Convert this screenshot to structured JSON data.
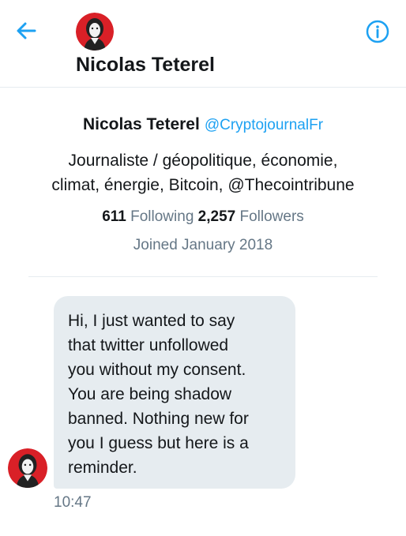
{
  "header": {
    "title": "Nicolas Teterel",
    "back_icon": "arrow-left-icon",
    "info_icon": "info-circle-icon",
    "accent_color": "#1da1f2"
  },
  "profile": {
    "name": "Nicolas Teterel",
    "handle": "@CryptojournalFr",
    "bio_line1": "Journaliste / géopolitique, économie,",
    "bio_line2": "climat, énergie, Bitcoin, @Thecointribune",
    "following_count": "611",
    "following_label": "Following",
    "followers_count": "2,257",
    "followers_label": "Followers",
    "joined": "Joined January 2018"
  },
  "message": {
    "text": "Hi, I just wanted to say\nthat twitter unfollowed\nyou without my consent.\nYou are being shadow\nbanned. Nothing new for\nyou I guess but here is a\nreminder.",
    "time": "10:47"
  }
}
